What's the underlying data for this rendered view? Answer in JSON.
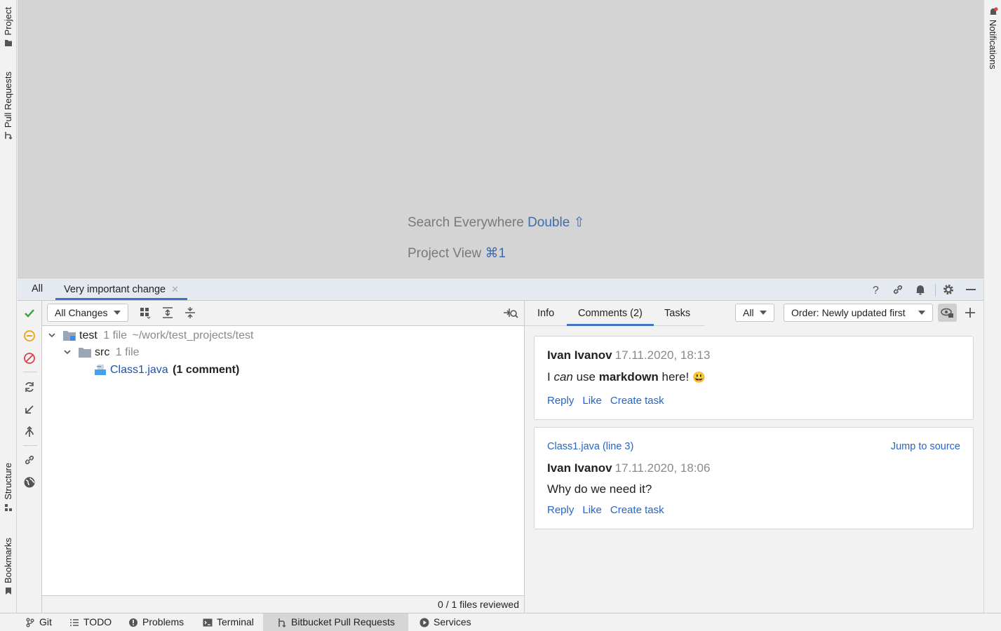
{
  "left_stripe": {
    "project": "Project",
    "pull_requests": "Pull Requests",
    "structure": "Structure",
    "bookmarks": "Bookmarks"
  },
  "right_stripe": {
    "notifications": "Notifications"
  },
  "editor": {
    "search_label": "Search Everywhere",
    "search_key": "Double ⇧",
    "project_view_label": "Project View",
    "project_view_key": "⌘1"
  },
  "tool_window": {
    "tabs": [
      {
        "label": "All"
      },
      {
        "label": "Very important change",
        "closable": true
      }
    ]
  },
  "changes": {
    "filter_combo": "All Changes",
    "tree": {
      "root": {
        "name": "test",
        "count": "1 file",
        "path": "~/work/test_projects/test"
      },
      "folder": {
        "name": "src",
        "count": "1 file"
      },
      "file": {
        "name": "Class1.java",
        "comment_count": "(1 comment)"
      }
    },
    "status": "0 / 1 files reviewed"
  },
  "details": {
    "tabs": [
      {
        "label": "Info"
      },
      {
        "label": "Comments (2)",
        "active": true
      },
      {
        "label": "Tasks"
      }
    ],
    "filter_combo": "All",
    "order_combo": "Order: Newly updated first",
    "comments": [
      {
        "author": "Ivan Ivanov",
        "timestamp": "17.11.2020, 18:13",
        "body": {
          "t1": "I ",
          "t2": "can",
          "t3": " use ",
          "t4": "markdown",
          "t5": " here! ",
          "emoji": "😃"
        },
        "actions": [
          "Reply",
          "Like",
          "Create task"
        ]
      },
      {
        "file_ref": "Class1.java (line 3)",
        "jump": "Jump to source",
        "author": "Ivan Ivanov",
        "timestamp": "17.11.2020, 18:06",
        "body_text": "Why do we need it?",
        "actions": [
          "Reply",
          "Like",
          "Create task"
        ]
      }
    ]
  },
  "statusbar": {
    "items": [
      {
        "label": "Git",
        "icon": "git-branch-icon"
      },
      {
        "label": "TODO",
        "icon": "list-icon"
      },
      {
        "label": "Problems",
        "icon": "problems-icon"
      },
      {
        "label": "Terminal",
        "icon": "terminal-icon"
      },
      {
        "label": "Bitbucket Pull Requests",
        "icon": "pull-request-icon",
        "active": true
      },
      {
        "label": "Services",
        "icon": "services-icon"
      }
    ]
  },
  "colors": {
    "accent": "#3d73c9",
    "link": "#2765c4",
    "editor_bg": "#d4d4d4"
  }
}
